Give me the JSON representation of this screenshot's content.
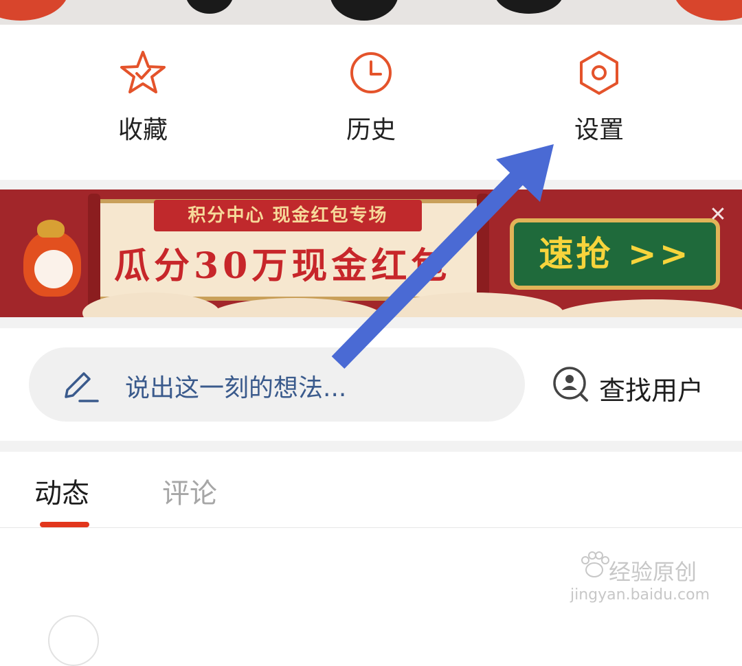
{
  "quick_actions": [
    {
      "label": "收藏",
      "icon": "star-check-icon"
    },
    {
      "label": "历史",
      "icon": "clock-icon"
    },
    {
      "label": "设置",
      "icon": "hexagon-gear-icon"
    }
  ],
  "banner": {
    "title": "积分中心 现金红包专场",
    "headline": "瓜分30万现金红包",
    "cta": "速抢 >>",
    "close_icon": "close-icon"
  },
  "status_input": {
    "placeholder": "说出这一刻的想法...",
    "icon": "pencil-icon"
  },
  "find_user": {
    "label": "查找用户",
    "icon": "user-search-icon"
  },
  "tabs": [
    {
      "label": "动态",
      "active": true
    },
    {
      "label": "评论",
      "active": false
    }
  ],
  "watermark": {
    "text": "经验原创",
    "url": "jingyan.baidu.com"
  },
  "colors": {
    "accent": "#e2361c",
    "icon": "#e4532b",
    "arrow": "#4a6ad4",
    "banner_bg": "#a2262a",
    "cta_bg": "#1f6a3b"
  }
}
